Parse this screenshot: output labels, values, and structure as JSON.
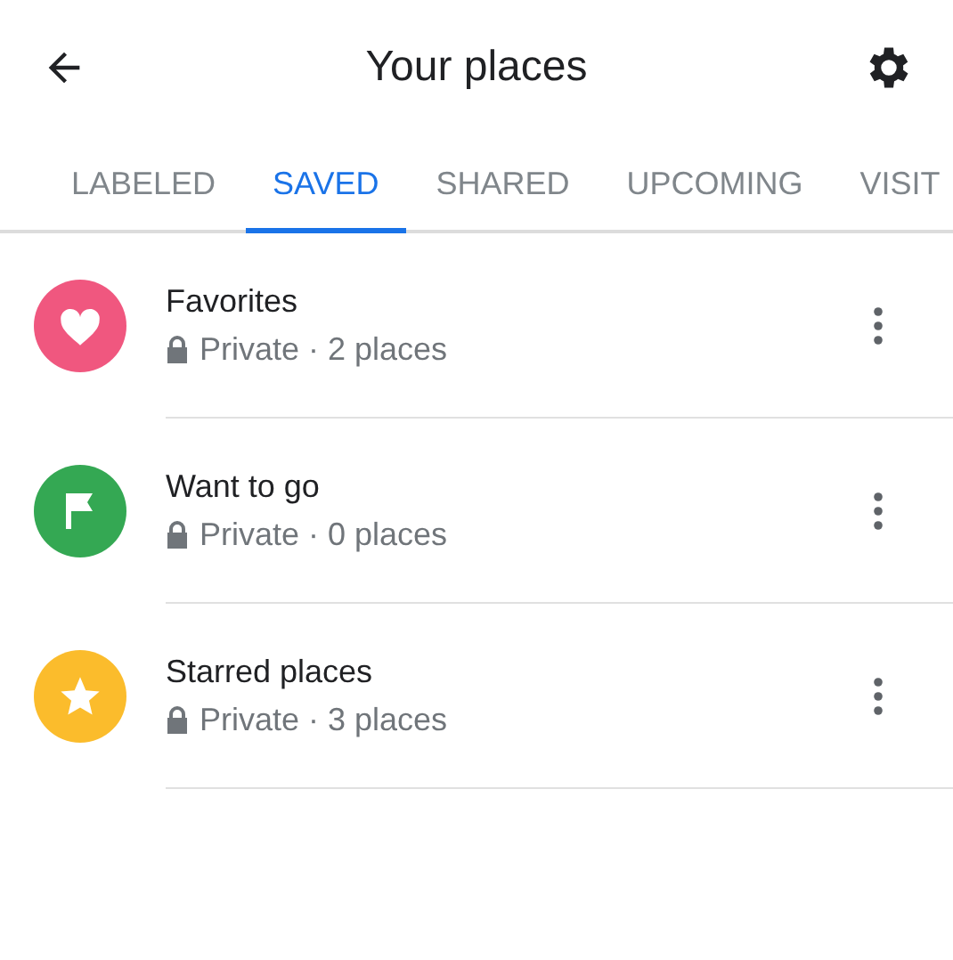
{
  "header": {
    "title": "Your places"
  },
  "tabs": [
    {
      "label": "LABELED",
      "selected": false
    },
    {
      "label": "SAVED",
      "selected": true
    },
    {
      "label": "SHARED",
      "selected": false
    },
    {
      "label": "UPCOMING",
      "selected": false
    },
    {
      "label": "VISIT",
      "selected": false
    }
  ],
  "lists": [
    {
      "kind": "heart",
      "color": "#f0577f",
      "title": "Favorites",
      "subtitle": "Private · 2 places"
    },
    {
      "kind": "flag",
      "color": "#34a853",
      "title": "Want to go",
      "subtitle": "Private · 0 places"
    },
    {
      "kind": "star",
      "color": "#fbbc2c",
      "title": "Starred places",
      "subtitle": "Private · 3 places"
    }
  ]
}
